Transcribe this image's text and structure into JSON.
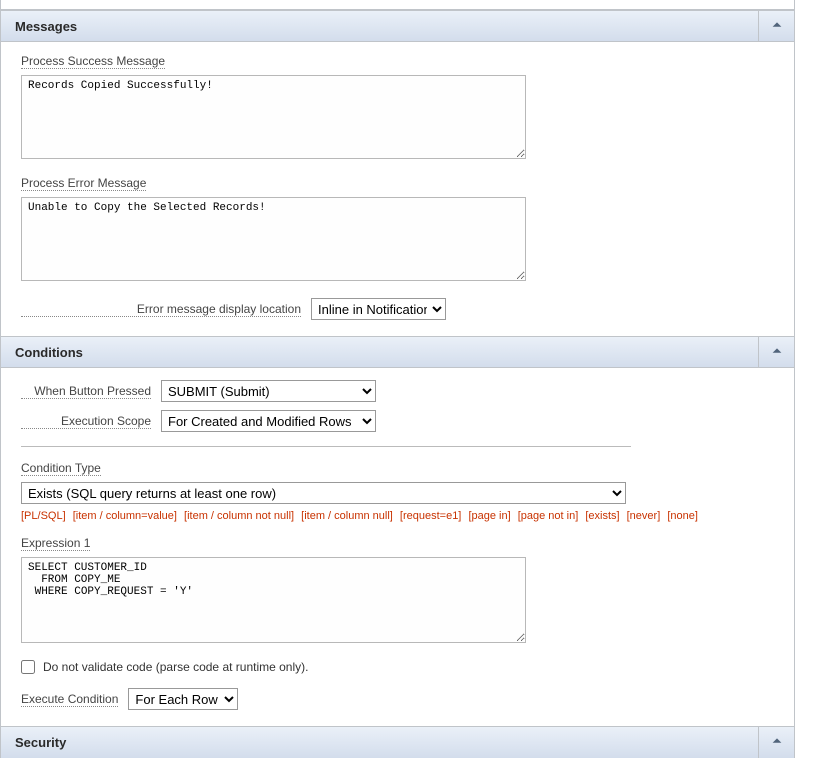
{
  "sections": {
    "messages": {
      "title": "Messages",
      "success_label": "Process Success Message",
      "success_value": "Records Copied Successfully!",
      "error_label": "Process Error Message",
      "error_value": "Unable to Copy the Selected Records!",
      "error_location_label": "Error message display location",
      "error_location_value": "Inline in Notification"
    },
    "conditions": {
      "title": "Conditions",
      "button_label": "When Button Pressed",
      "button_value": "SUBMIT (Submit)",
      "scope_label": "Execution Scope",
      "scope_value": "For Created and Modified Rows",
      "cond_type_label": "Condition Type",
      "cond_type_value": "Exists (SQL query returns at least one row)",
      "quick": {
        "plsql": "[PL/SQL]",
        "item_col_val": "[item / column=value]",
        "item_col_notnull": "[item / column not null]",
        "item_col_null": "[item / column null]",
        "req_e1": "[request=e1]",
        "page_in": "[page in]",
        "page_not_in": "[page not in]",
        "exists": "[exists]",
        "never": "[never]",
        "none": "[none]"
      },
      "expr1_label": "Expression 1",
      "expr1_value": "SELECT CUSTOMER_ID\n  FROM COPY_ME\n WHERE COPY_REQUEST = 'Y'",
      "validate_label": "Do not validate code (parse code at runtime only).",
      "exec_cond_label": "Execute Condition",
      "exec_cond_value": "For Each Row"
    },
    "security": {
      "title": "Security"
    }
  }
}
